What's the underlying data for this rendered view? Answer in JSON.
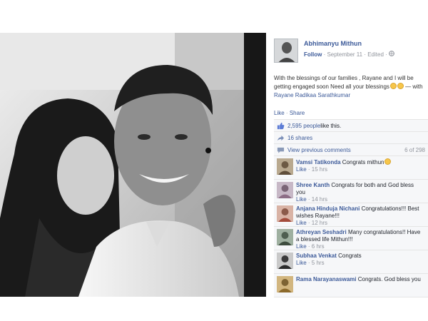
{
  "post": {
    "author": "Abhimanyu Mithun",
    "follow": "Follow",
    "meta": "· September 11 · Edited ·",
    "text": "With the blessings of our families , Rayane and I will be getting engaged soon Need all your blessings",
    "with_prefix": "— with",
    "with_name": "Rayane Radikaa Sarathkumar",
    "like_action": "Like",
    "share_action": "Share"
  },
  "feedback": {
    "likes_count": "2,595 people",
    "likes_suffix": " like this.",
    "shares": "16 shares",
    "view_previous": "View previous comments",
    "comment_count": "6 of 298"
  },
  "comments": [
    {
      "name": "Vamsi Tatikonda",
      "text": "Congrats mithun",
      "like": "Like",
      "time": "· 15 hrs"
    },
    {
      "name": "Shree Kanth",
      "text": "Congrats for both and God bless you",
      "like": "Like",
      "time": "· 14 hrs"
    },
    {
      "name": "Anjana Hinduja Nichani",
      "text": "Congratulations!!! Best wishes Rayane!!!",
      "like": "Like",
      "time": "· 12 hrs"
    },
    {
      "name": "Athreyan Seshadri",
      "text": "Many congratulations!! Have a blessed life Mithun!!!",
      "like": "Like",
      "time": "· 6 hrs"
    },
    {
      "name": "Subhaa Venkat",
      "text": "Congrats",
      "like": "Like",
      "time": "· 5 hrs"
    },
    {
      "name": "Rama Narayanaswami",
      "text": "Congrats. God bless you",
      "like": "",
      "time": ""
    }
  ],
  "icons": {
    "privacy": "globe-icon",
    "likes": "thumbs-up-icon",
    "shares": "share-icon",
    "comments": "comment-bubble-icon"
  }
}
